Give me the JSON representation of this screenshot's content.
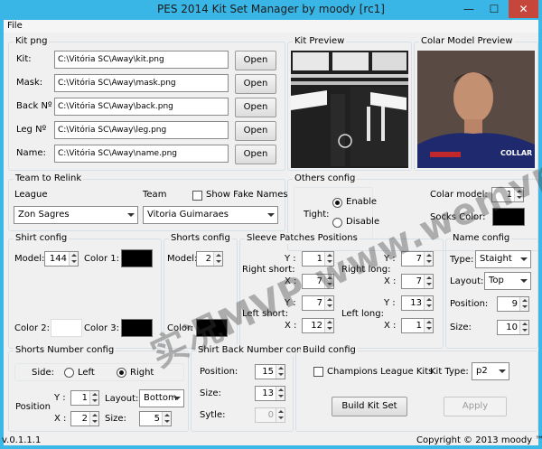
{
  "window": {
    "title": "PES 2014 Kit Set Manager by moody [rc1]"
  },
  "menu": {
    "file": "File"
  },
  "kit_png": {
    "caption": "Kit png",
    "rows": [
      {
        "label": "Kit:",
        "value": "C:\\Vitória SC\\Away\\kit.png",
        "button": "Open"
      },
      {
        "label": "Mask:",
        "value": "C:\\Vitória SC\\Away\\mask.png",
        "button": "Open"
      },
      {
        "label": "Back Nº",
        "value": "C:\\Vitória SC\\Away\\back.png",
        "button": "Open"
      },
      {
        "label": "Leg Nº",
        "value": "C:\\Vitória SC\\Away\\leg.png",
        "button": "Open"
      },
      {
        "label": "Name:",
        "value": "C:\\Vitória SC\\Away\\name.png",
        "button": "Open"
      }
    ]
  },
  "kit_preview": {
    "caption": "Kit Preview"
  },
  "colar_preview": {
    "caption": "Colar Model Preview",
    "overlay_text": "COLLAR"
  },
  "team_relink": {
    "caption": "Team to Relink",
    "league_label": "League",
    "team_label": "Team",
    "show_fake_label": "Show Fake Names",
    "league_value": "Zon Sagres",
    "team_value": "Vitoria Guimaraes"
  },
  "others_config": {
    "caption": "Others config",
    "tight_label": "Tight:",
    "enable_label": "Enable",
    "disable_label": "Disable",
    "tight_selected": "Enable",
    "colar_model_label": "Colar model:",
    "colar_model_value": "1",
    "socks_color_label": "Socks Color:"
  },
  "shirt_config": {
    "caption": "Shirt config",
    "model_label": "Model:",
    "model_value": "144",
    "color1_label": "Color 1:",
    "color2_label": "Color 2:",
    "color3_label": "Color 3:"
  },
  "shorts_config": {
    "caption": "Shorts config",
    "model_label": "Model:",
    "model_value": "2",
    "color_label": "Color:"
  },
  "sleeve_patches": {
    "caption": "Sleeve Patches Positions",
    "right_short": "Right short:",
    "left_short": "Left short:",
    "right_long": "Right long:",
    "left_long": "Left long:",
    "y": "Y :",
    "x": "X :",
    "right_short_y": "1",
    "right_short_x": "7",
    "left_short_y": "7",
    "left_short_x": "12",
    "right_long_y": "7",
    "right_long_x": "7",
    "left_long_y": "13",
    "left_long_x": "1"
  },
  "name_config": {
    "caption": "Name config",
    "type_label": "Type:",
    "type_value": "Staight",
    "layout_label": "Layout:",
    "layout_value": "Top",
    "position_label": "Position:",
    "position_value": "9",
    "size_label": "Size:",
    "size_value": "10"
  },
  "shorts_number": {
    "caption": "Shorts Number config",
    "side_label": "Side:",
    "left_label": "Left",
    "right_label": "Right",
    "side_selected": "Right",
    "position_label": "Position",
    "y_label": "Y :",
    "x_label": "X :",
    "y_value": "1",
    "x_value": "2",
    "layout_label": "Layout:",
    "layout_value": "Bottom",
    "size_label": "Size:",
    "size_value": "5"
  },
  "shirt_back_number": {
    "caption": "Shirt Back Number config",
    "position_label": "Position:",
    "position_value": "15",
    "size_label": "Size:",
    "size_value": "13",
    "style_label": "Sytle:",
    "style_value": "0"
  },
  "build_config": {
    "caption": "Build config",
    "champions_label": "Champions League Kits",
    "kit_type_label": "Kit Type:",
    "kit_type_value": "p2",
    "build_button": "Build Kit Set",
    "apply_button": "Apply"
  },
  "status": {
    "version": "v.0.1.1.1",
    "copyright": "Copyright © 2013 moody ™"
  },
  "watermark": "实况MVP www.wemvp.com",
  "colors": {
    "title_bar": "#39b6e6",
    "panel": "#f0f0f0",
    "swatch_black": "#000000",
    "swatch_white": "#ffffff"
  }
}
